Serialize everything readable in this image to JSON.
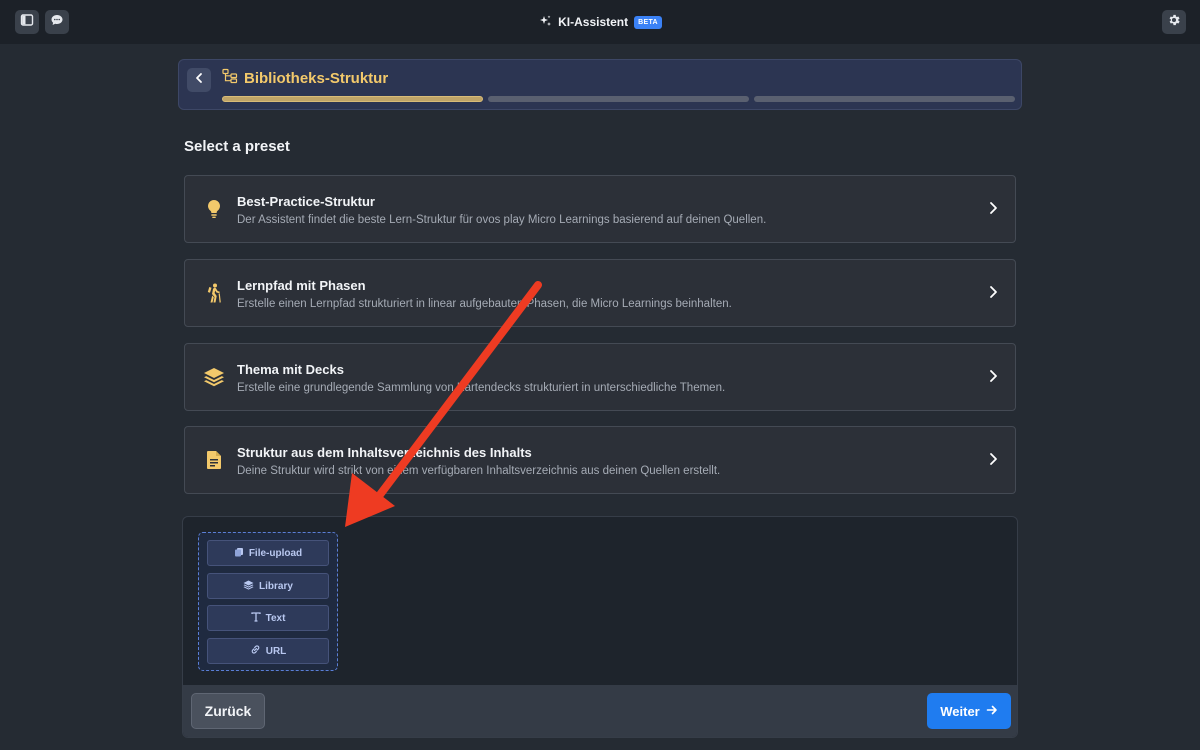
{
  "topbar": {
    "title": "KI-Assistent",
    "badge": "BETA",
    "left_icons": [
      "sidebar-icon",
      "chat-bubble-icon"
    ],
    "right_icons": [
      "gear-icon"
    ]
  },
  "header": {
    "title": "Bibliotheks-Struktur",
    "icon": "structure-icon",
    "progress": {
      "steps": 3,
      "current": 1
    }
  },
  "section": {
    "title": "Select a preset"
  },
  "presets": [
    {
      "title": "Best-Practice-Struktur",
      "description": "Der Assistent findet die beste Lern-Struktur für ovos play Micro Learnings basierend auf deinen Quellen.",
      "icon": "lightbulb-icon"
    },
    {
      "title": "Lernpfad mit Phasen",
      "description": "Erstelle einen Lernpfad strukturiert in linear aufgebauten Phasen, die Micro Learnings beinhalten.",
      "icon": "hiker-icon"
    },
    {
      "title": "Thema mit Decks",
      "description": "Erstelle eine grundlegende Sammlung von Kartendecks strukturiert in unterschiedliche Themen.",
      "icon": "layers-icon"
    },
    {
      "title": "Struktur aus dem Inhaltsverzeichnis des Inhalts",
      "description": "Deine Struktur wird strikt von einem verfügbaren Inhaltsverzeichnis aus deinen Quellen erstellt.",
      "icon": "document-icon"
    }
  ],
  "sources": [
    {
      "label": "File-upload",
      "icon": "files-icon"
    },
    {
      "label": "Library",
      "icon": "layers-icon"
    },
    {
      "label": "Text",
      "icon": "text-icon"
    },
    {
      "label": "URL",
      "icon": "link-icon"
    }
  ],
  "footer": {
    "back_label": "Zurück",
    "next_label": "Weiter"
  },
  "colors": {
    "accent": "#f3c96b",
    "primary_button": "#1f7cf0",
    "annotation_arrow": "#ee3b22"
  }
}
